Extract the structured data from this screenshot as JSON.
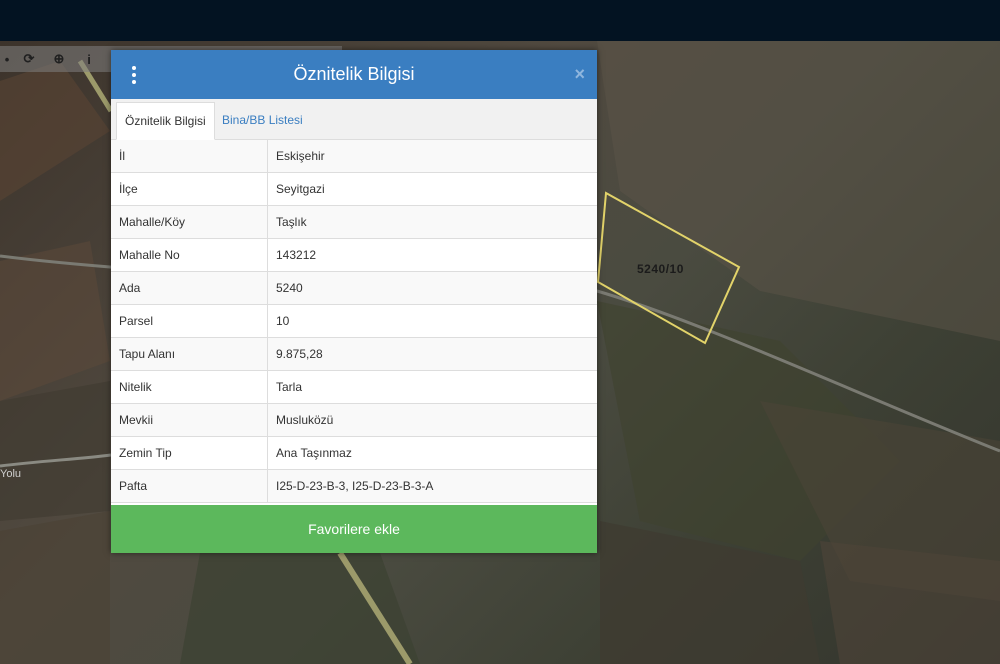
{
  "toolbar": {
    "items": [
      {
        "icon": "minus-icon",
        "glyph": "•"
      },
      {
        "icon": "refresh-icon",
        "glyph": "⟳"
      },
      {
        "icon": "locate-icon",
        "glyph": "⊕"
      },
      {
        "icon": "info-icon",
        "glyph": "i"
      }
    ]
  },
  "map": {
    "parcel_label": "5240/10",
    "road_label": "Yolu"
  },
  "dialog": {
    "title": "Öznitelik Bilgisi",
    "close_glyph": "×",
    "tabs": [
      {
        "label": "Öznitelik Bilgisi",
        "active": true
      },
      {
        "label": "Bina/BB Listesi",
        "active": false
      }
    ],
    "rows": [
      {
        "key": "İl",
        "value": "Eskişehir"
      },
      {
        "key": "İlçe",
        "value": "Seyitgazi"
      },
      {
        "key": "Mahalle/Köy",
        "value": "Taşlık"
      },
      {
        "key": "Mahalle No",
        "value": "143212"
      },
      {
        "key": "Ada",
        "value": "5240"
      },
      {
        "key": "Parsel",
        "value": "10"
      },
      {
        "key": "Tapu Alanı",
        "value": "9.875,28"
      },
      {
        "key": "Nitelik",
        "value": "Tarla"
      },
      {
        "key": "Mevkii",
        "value": "Musluközü"
      },
      {
        "key": "Zemin Tip",
        "value": "Ana Taşınmaz"
      },
      {
        "key": "Pafta",
        "value": "I25-D-23-B-3, I25-D-23-B-3-A"
      }
    ],
    "favorite_button": "Favorilere ekle"
  },
  "colors": {
    "header": "#3a7ec1",
    "favorite": "#5cb85c",
    "topbar": "#031322",
    "parcel_outline": "#e2d36a"
  }
}
